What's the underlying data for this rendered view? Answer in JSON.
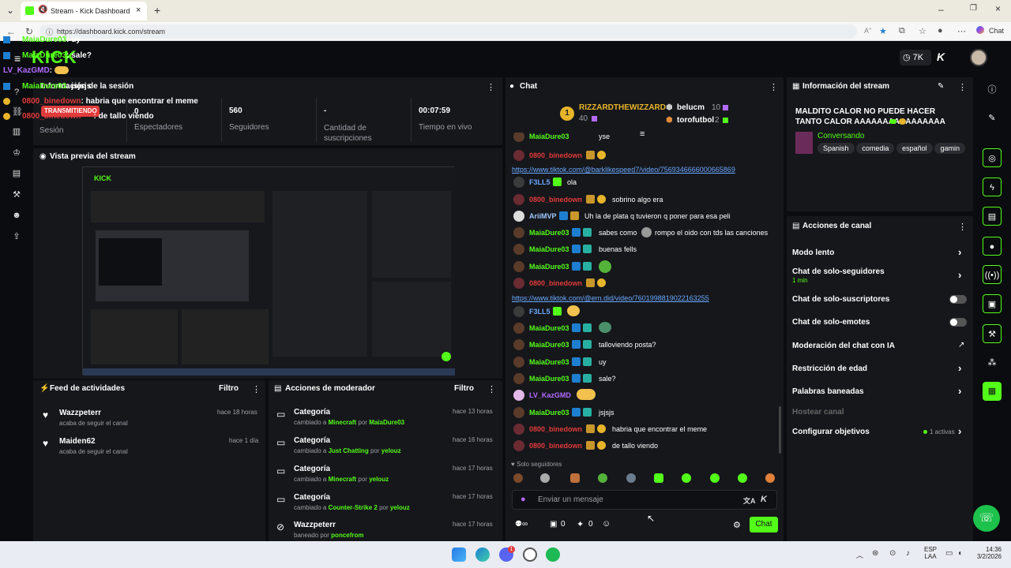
{
  "browser": {
    "tab_title": "Stream - Kick Dashboard",
    "url": "https://dashboard.kick.com/stream",
    "chat_button": "Chat",
    "read_aloud": "Aʺ"
  },
  "topbar": {
    "logo": "KICK",
    "viewers": "7K"
  },
  "overlay": {
    "lines": [
      {
        "name": "MaiaDure03",
        "text": ": uy",
        "color": "#53fc18"
      },
      {
        "name": "MaiaDure03",
        "text": ": sale?",
        "color": "#53fc18"
      },
      {
        "name": "LV_KazGMD",
        "text": ":",
        "color": "#b36bff"
      },
      {
        "name": "MaiaDure03",
        "text": ": jsjsjs",
        "color": "#53fc18"
      },
      {
        "name": "0800_binedown",
        "text": ": habria que encontrar el meme",
        "color": "#e23b3b"
      },
      {
        "name": "0800_binedown",
        "text": ": de tallo viendo",
        "color": "#e23b3b"
      }
    ],
    "live_badge": "TRANSMITIENDO",
    "session_label": "Información de la sesión",
    "zero": "0"
  },
  "session": {
    "stats": [
      {
        "value": "",
        "label": "Sesión"
      },
      {
        "value": "",
        "label": "Espectadores"
      },
      {
        "value": "560",
        "label": "Seguidores"
      },
      {
        "value": "-",
        "label": "Cantidad de suscripciones"
      },
      {
        "value": "00:07:59",
        "label": "Tiempo en vivo"
      }
    ]
  },
  "preview": {
    "title": "Vista previa del stream"
  },
  "activity": {
    "title": "Feed de actividades",
    "filter": "Filtro",
    "items": [
      {
        "name": "Wazzpeterr",
        "desc": "acaba de seguir el canal",
        "time": "hace 18 horas"
      },
      {
        "name": "Maiden62",
        "desc": "acaba de seguir el canal",
        "time": "hace 1 día"
      }
    ]
  },
  "modactions": {
    "title": "Acciones de moderador",
    "filter": "Filtro",
    "items": [
      {
        "title": "Categoría",
        "pre": "cambiado a",
        "cat": "Minecraft",
        "by": "por",
        "user": "MaiaDure03",
        "time": "hace 13 horas"
      },
      {
        "title": "Categoría",
        "pre": "cambiado a",
        "cat": "Just Chatting",
        "by": "por",
        "user": "yelouz",
        "time": "hace 16 horas"
      },
      {
        "title": "Categoría",
        "pre": "cambiado a",
        "cat": "Minecraft",
        "by": "por",
        "user": "yelouz",
        "time": "hace 17 horas"
      },
      {
        "title": "Categoría",
        "pre": "cambiado a",
        "cat": "Counter-Strike 2",
        "by": "por",
        "user": "yelouz",
        "time": "hace 17 horas"
      },
      {
        "title": "Wazzpeterr",
        "pre": "baneado por",
        "cat": "poncefrom",
        "by": "",
        "user": "",
        "time": "hace 17 horas"
      }
    ]
  },
  "chat": {
    "title": "Chat",
    "leaderboard": {
      "first_name": "RIZZARDTHEWIZZARD",
      "first_points": "40",
      "rank": "1",
      "second_name": "belucm",
      "second_points": "10",
      "third_name": "torofutbol",
      "third_points": "2"
    },
    "messages": [
      {
        "name": "MaiaDure03",
        "text": "yse",
        "color": "#53fc18"
      },
      {
        "name": "0800_binedown",
        "text": "",
        "color": "#e23b3b"
      },
      {
        "name": "F3LL5",
        "text": "ola",
        "color": "#6aa9ff"
      },
      {
        "name": "0800_binedown",
        "text": "sobrino algo era",
        "color": "#e23b3b"
      },
      {
        "name": "AriiMVP",
        "text": "Uh la de plata q tuvieron q poner para esa peli",
        "color": "#9ec9ff"
      },
      {
        "name": "MaiaDure03",
        "text": "sabes como",
        "text2": "rompo el oido con tds las canciones",
        "color": "#53fc18"
      },
      {
        "name": "MaiaDure03",
        "text": "buenas fells",
        "color": "#53fc18"
      },
      {
        "name": "MaiaDure03",
        "text": "",
        "color": "#53fc18"
      },
      {
        "name": "0800_binedown",
        "text": "",
        "color": "#e23b3b"
      },
      {
        "name": "F3LL5",
        "text": "",
        "color": "#6aa9ff"
      },
      {
        "name": "MaiaDure03",
        "text": "",
        "color": "#53fc18"
      },
      {
        "name": "MaiaDure03",
        "text": "talloviendo posta?",
        "color": "#53fc18"
      },
      {
        "name": "MaiaDure03",
        "text": "uy",
        "color": "#53fc18"
      },
      {
        "name": "MaiaDure03",
        "text": "sale?",
        "color": "#53fc18"
      },
      {
        "name": "LV_KazGMD",
        "text": "",
        "color": "#b36bff"
      },
      {
        "name": "MaiaDure03",
        "text": "jsjsjs",
        "color": "#53fc18"
      },
      {
        "name": "0800_binedown",
        "text": "habria que encontrar el meme",
        "color": "#e23b3b"
      },
      {
        "name": "0800_binedown",
        "text": "de tallo viendo",
        "color": "#e23b3b"
      }
    ],
    "links": [
      "https://www.tiktok.com/@barklikespeed7/video/7569346666000665869",
      "https://www.tiktok.com/@ern.did/video/7601998819022163255"
    ],
    "followers_only": "Solo seguidores",
    "input_placeholder": "Enviar un mensaje",
    "count_a": "0",
    "count_b": "0",
    "send": "Chat"
  },
  "streaminfo": {
    "title": "Información del stream",
    "stream_title": "MALDITO CALOR NO PUEDE HACER TANTO CALOR AAAAAAAAAAAAAAAA",
    "category": "Conversando",
    "tags": [
      "Spanish",
      "comedia",
      "español",
      "gamin"
    ]
  },
  "channel": {
    "title": "Acciones de canal",
    "items": [
      {
        "label": "Modo lento",
        "kind": "chevron"
      },
      {
        "label": "Chat de solo-seguidores",
        "sub": "1 min",
        "kind": "chevron"
      },
      {
        "label": "Chat de solo-suscriptores",
        "kind": "toggle"
      },
      {
        "label": "Chat de solo-emotes",
        "kind": "toggle"
      },
      {
        "label": "Moderación del chat con IA",
        "kind": "external"
      },
      {
        "label": "Restricción de edad",
        "kind": "chevron"
      },
      {
        "label": "Palabras baneadas",
        "kind": "chevron"
      },
      {
        "label": "Hostear canal",
        "kind": "disabled"
      },
      {
        "label": "Configurar objetivos",
        "status": "1 activas",
        "kind": "chevron"
      }
    ]
  },
  "taskbar": {
    "lang": "ESP",
    "lang2": "LAA",
    "time": "14:36",
    "date": "3/2/2026",
    "notif": "1"
  },
  "colors": {
    "accent": "#53fc18",
    "live": "#e23b3b",
    "panel": "#16171b"
  }
}
